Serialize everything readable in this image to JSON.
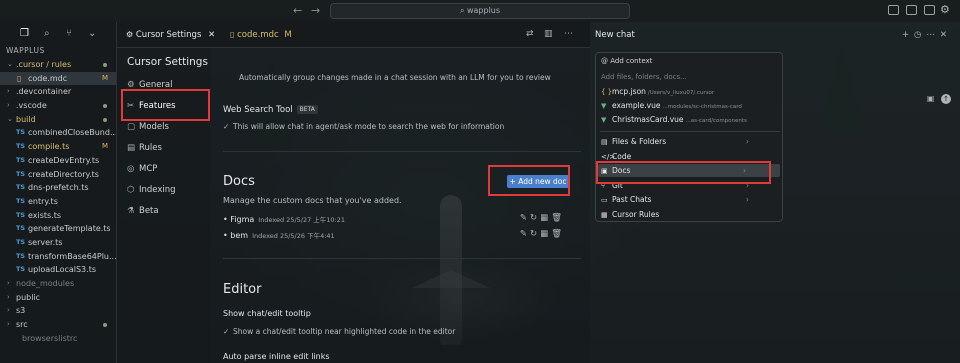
{
  "titlebar": {
    "search": "wapplus",
    "back": "←",
    "forward": "→"
  },
  "explorer": {
    "title": "WAPPLUS",
    "items": [
      {
        "label": ".cursor / rules",
        "chev": "⌄",
        "color": "yellow",
        "dot": true
      },
      {
        "label": "code.mdc",
        "badge": "M",
        "icon": "md-file-icon",
        "selected": true
      },
      {
        "label": ".devcontainer",
        "chev": "›"
      },
      {
        "label": ".vscode",
        "chev": "›",
        "dot": true
      },
      {
        "label": "build",
        "chev": "⌄",
        "color": "yellow",
        "dot": true
      },
      {
        "label": "combinedCloseBund...",
        "ts": true
      },
      {
        "label": "compile.ts",
        "ts": true,
        "badge": "M",
        "color": "yellow"
      },
      {
        "label": "createDevEntry.ts",
        "ts": true
      },
      {
        "label": "createDirectory.ts",
        "ts": true
      },
      {
        "label": "dns-prefetch.ts",
        "ts": true
      },
      {
        "label": "entry.ts",
        "ts": true
      },
      {
        "label": "exists.ts",
        "ts": true
      },
      {
        "label": "generateTemplate.ts",
        "ts": true
      },
      {
        "label": "server.ts",
        "ts": true
      },
      {
        "label": "transformBase64Plu...",
        "ts": true
      },
      {
        "label": "uploadLocalS3.ts",
        "ts": true
      },
      {
        "label": "node_modules",
        "chev": "›",
        "color": "dim"
      },
      {
        "label": "public",
        "chev": "›"
      },
      {
        "label": "s3",
        "chev": "›"
      },
      {
        "label": "src",
        "chev": "›",
        "dot": true
      },
      {
        "label": "browserslistrc",
        "color": "dim"
      }
    ]
  },
  "tabs": {
    "settings": "Cursor Settings",
    "file": "code.mdc",
    "file_badge": "M",
    "close": "✕"
  },
  "settings_nav": {
    "title": "Cursor Settings",
    "items": [
      {
        "label": "General",
        "icon": "⚙"
      },
      {
        "label": "Features",
        "icon": "✂"
      },
      {
        "label": "Models",
        "icon": "▢"
      },
      {
        "label": "Rules",
        "icon": "▤"
      },
      {
        "label": "MCP",
        "icon": "◎"
      },
      {
        "label": "Indexing",
        "icon": "⬡"
      },
      {
        "label": "Beta",
        "icon": "⚗"
      }
    ]
  },
  "settings": {
    "auto_group_text": "Automatically group changes made in a chat session with an LLM for you to review",
    "web_search_title": "Web Search Tool",
    "beta_badge": "BETA",
    "web_search_desc": "This will allow chat in agent/ask mode to search the web for information",
    "docs_title": "Docs",
    "docs_desc": "Manage the custom docs that you've added.",
    "add_doc_label": "+ Add new doc",
    "docs": [
      {
        "name": "Figma",
        "meta": "Indexed 25/5/27 上午10:21"
      },
      {
        "name": "bem",
        "meta": "Indexed 25/5/26 下午4:41"
      }
    ],
    "editor_title": "Editor",
    "tooltip_title": "Show chat/edit tooltip",
    "tooltip_desc": "Show a chat/edit tooltip near highlighted code in the editor",
    "auto_parse_title": "Auto parse inline edit links"
  },
  "chat": {
    "title": "New chat",
    "add_context": "Add context",
    "search_placeholder": "Add files, folders, docs...",
    "recent": [
      {
        "name": "mcp.json",
        "path": "/Users/v_liuxu07/.cursor",
        "icon": "{ }",
        "color": "#d7c06a"
      },
      {
        "name": "example.vue",
        "path": "...modules/sc-christmas-card",
        "icon": "▼",
        "color": "#59b787"
      },
      {
        "name": "ChristmasCard.vue",
        "path": "...as-card/components",
        "icon": "▼",
        "color": "#59b787"
      }
    ],
    "menu": [
      {
        "label": "Files & Folders",
        "icon": "▤",
        "chev": "›"
      },
      {
        "label": "Code",
        "icon": "</>",
        "chev": ""
      },
      {
        "label": "Docs",
        "icon": "▣",
        "chev": "›",
        "highlight": true
      },
      {
        "label": "Git",
        "icon": "⑂",
        "chev": "›"
      },
      {
        "label": "Past Chats",
        "icon": "▭",
        "chev": "›"
      },
      {
        "label": "Cursor Rules",
        "icon": "▦",
        "chev": ""
      }
    ]
  }
}
